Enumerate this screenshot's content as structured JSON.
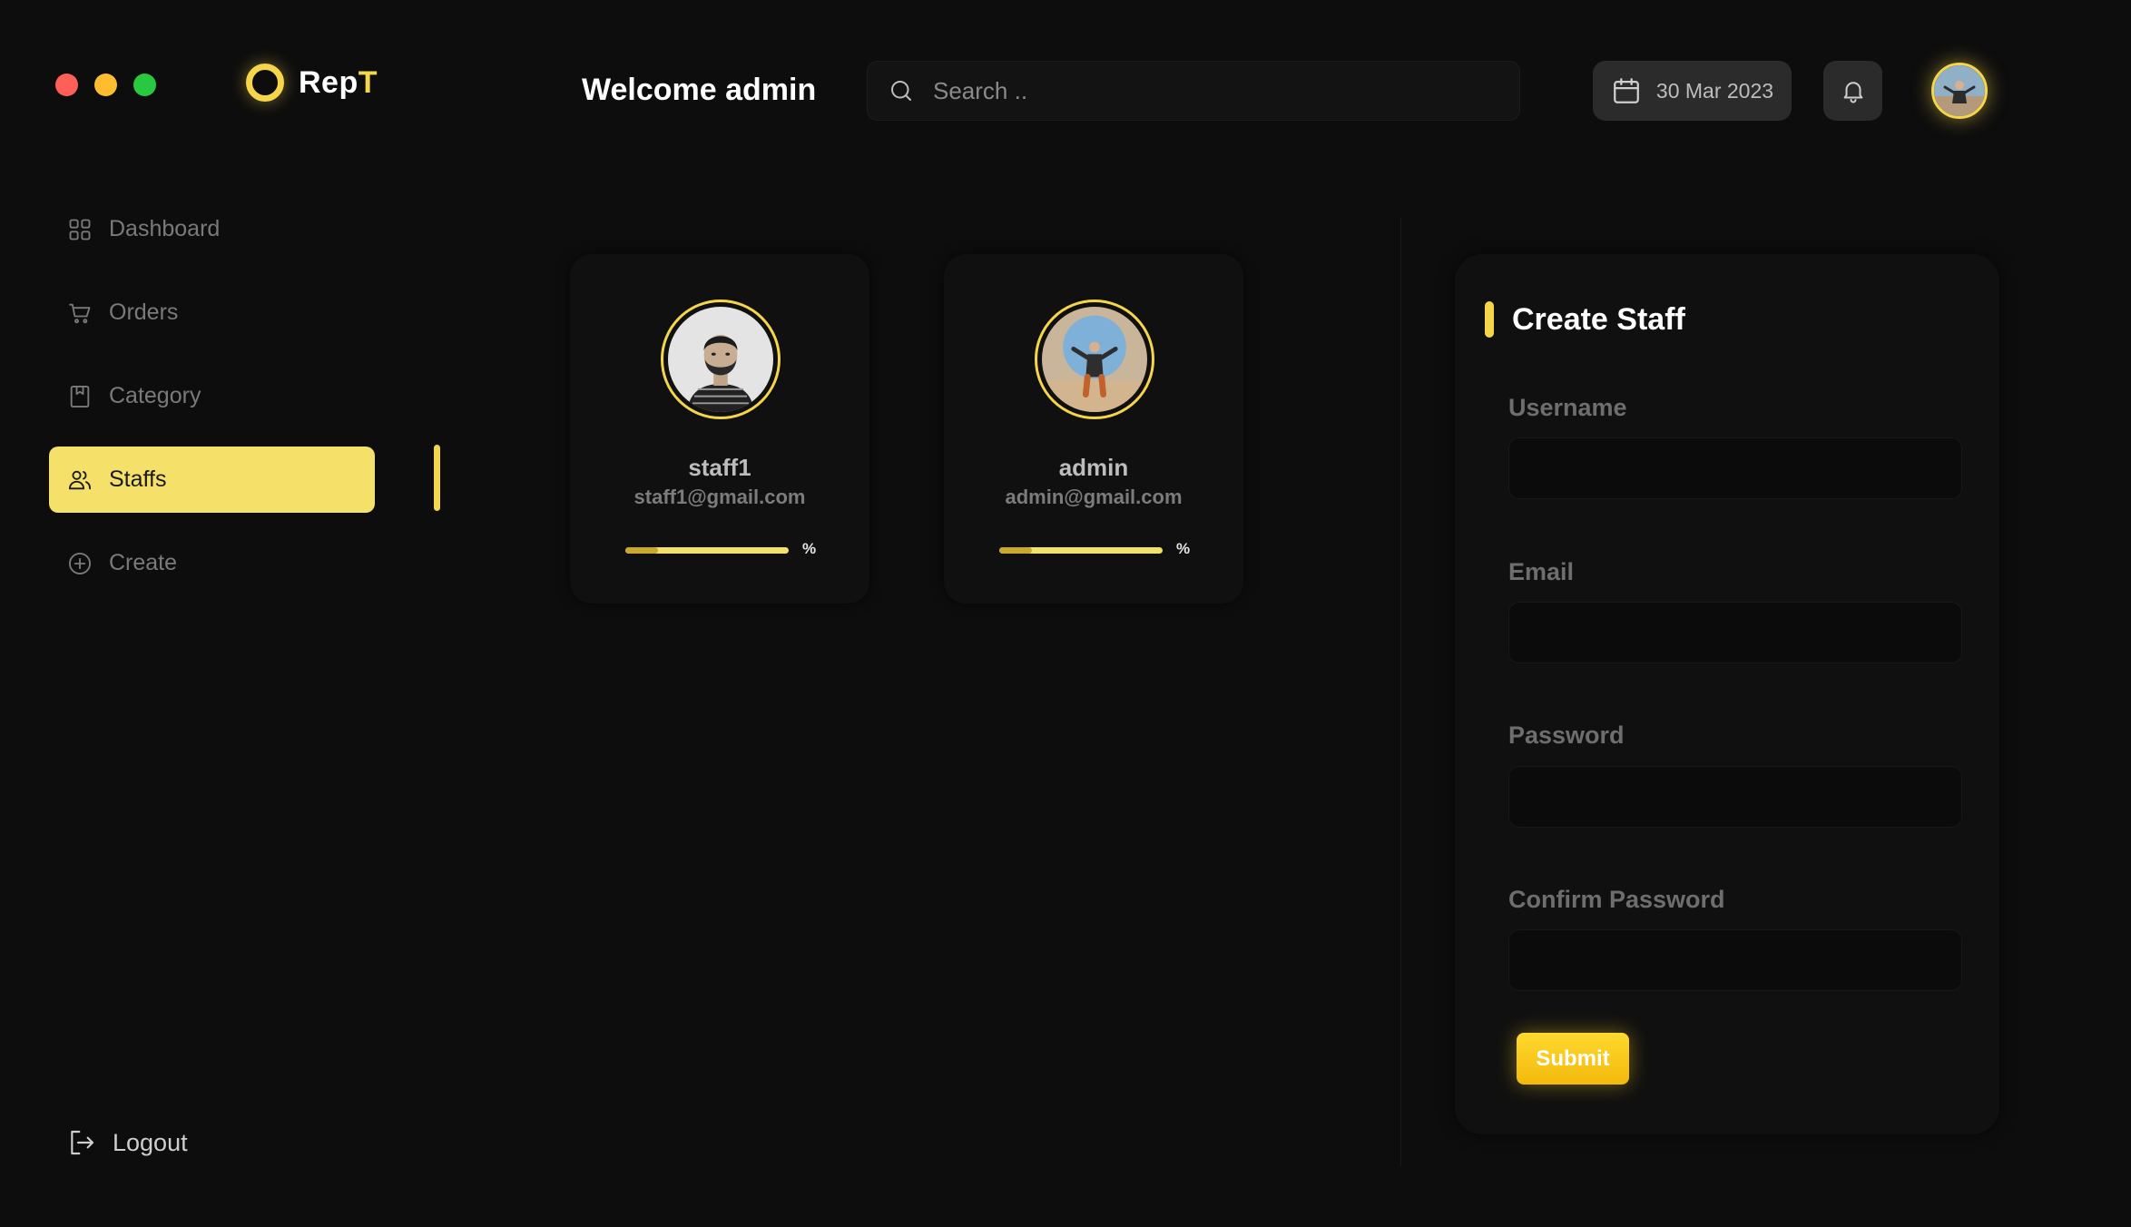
{
  "window": {
    "controls": [
      "close",
      "minimize",
      "maximize"
    ]
  },
  "brand": {
    "name_main": "Rep",
    "name_accent": "T",
    "accent_color": "#f5d54a"
  },
  "header": {
    "welcome": "Welcome admin",
    "search_placeholder": "Search ..",
    "date": "30 Mar 2023",
    "icons": {
      "search": "search-icon",
      "date": "calendar-icon",
      "notifications": "bell-icon"
    }
  },
  "sidebar": {
    "items": [
      {
        "label": "Dashboard",
        "icon": "grid-icon",
        "active": false
      },
      {
        "label": "Orders",
        "icon": "cart-icon",
        "active": false
      },
      {
        "label": "Category",
        "icon": "bookmark-icon",
        "active": false
      },
      {
        "label": "Staffs",
        "icon": "users-icon",
        "active": true
      },
      {
        "label": "Create",
        "icon": "plus-circle-icon",
        "active": false
      }
    ],
    "logout_label": "Logout"
  },
  "staff": [
    {
      "name": "staff1",
      "email": "staff1@gmail.com",
      "percent_symbol": "%",
      "progress": 0.2
    },
    {
      "name": "admin",
      "email": "admin@gmail.com",
      "percent_symbol": "%",
      "progress": 0.2
    }
  ],
  "create_form": {
    "title": "Create Staff",
    "fields": [
      {
        "label": "Username",
        "value": ""
      },
      {
        "label": "Email",
        "value": ""
      },
      {
        "label": "Password",
        "value": ""
      },
      {
        "label": "Confirm Password",
        "value": ""
      }
    ],
    "submit_label": "Submit"
  }
}
